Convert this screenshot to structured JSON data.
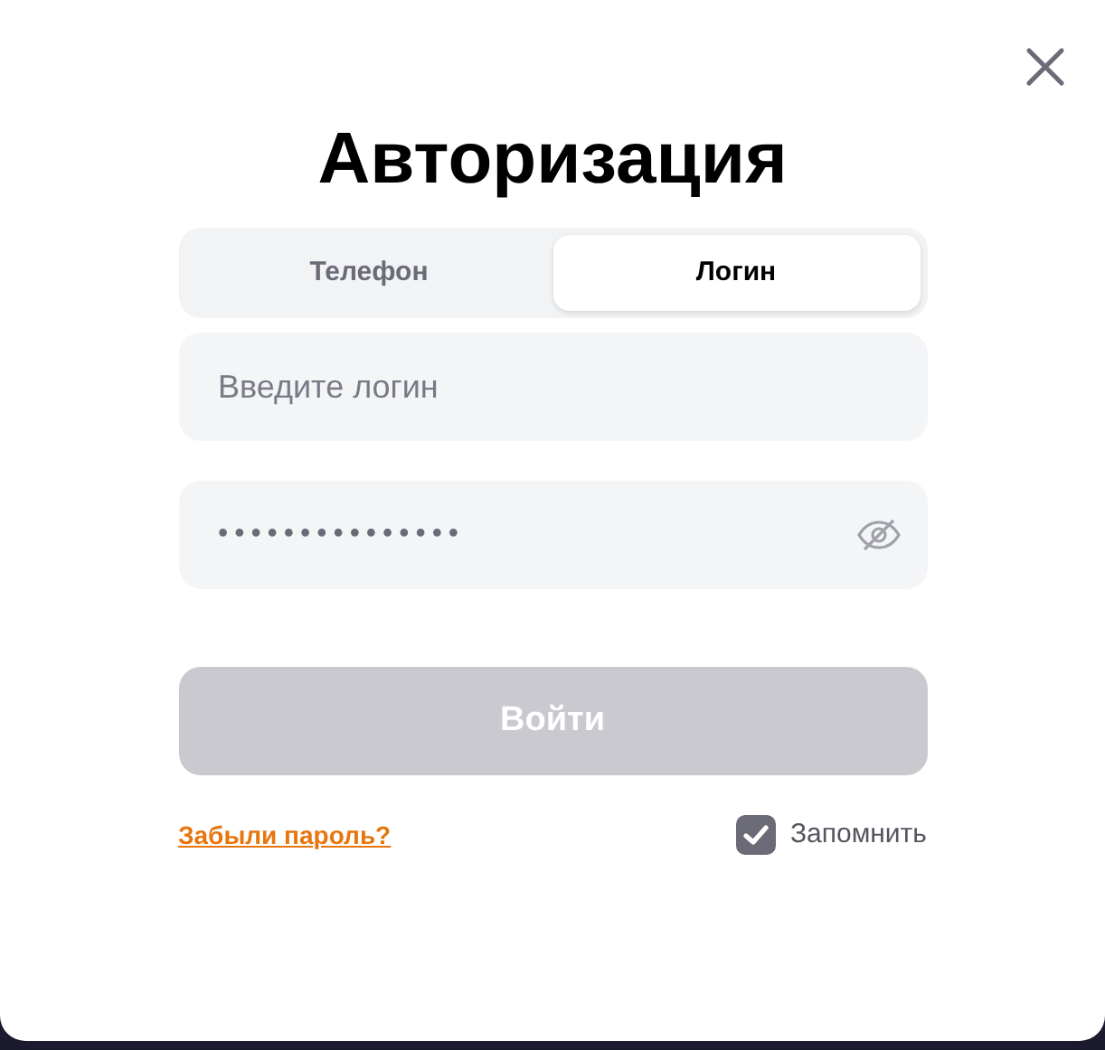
{
  "dialog": {
    "title": "Авторизация"
  },
  "tabs": [
    {
      "label": "Телефон",
      "selected": false
    },
    {
      "label": "Логин",
      "selected": true
    }
  ],
  "login_field": {
    "placeholder": "Введите логин"
  },
  "password_field": {
    "value": "•••••••••••••••"
  },
  "submit_button": {
    "label": "Войти",
    "disabled": true
  },
  "forgot_link": {
    "label": "Забыли пароль?"
  },
  "remember": {
    "label": "Запомнить",
    "checked": true
  }
}
